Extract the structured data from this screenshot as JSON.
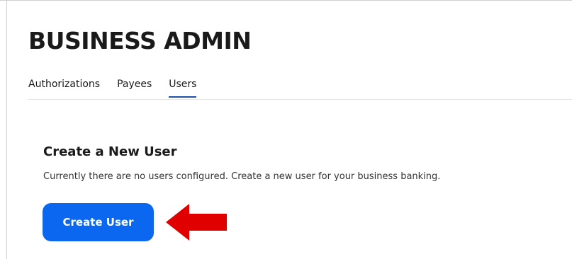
{
  "header": {
    "title": "BUSINESS ADMIN"
  },
  "tabs": [
    {
      "label": "Authorizations",
      "active": false
    },
    {
      "label": "Payees",
      "active": false
    },
    {
      "label": "Users",
      "active": true
    }
  ],
  "section": {
    "title": "Create a New User",
    "description": "Currently there are no users configured. Create a new user for your business banking.",
    "button_label": "Create User"
  },
  "colors": {
    "accent": "#0b67f0",
    "tab_underline": "#1f4fa8",
    "annotation_arrow": "#e00000"
  }
}
